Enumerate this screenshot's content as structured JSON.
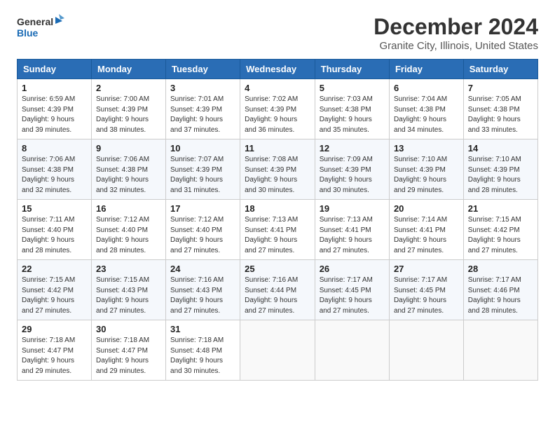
{
  "logo": {
    "line1": "General",
    "line2": "Blue"
  },
  "title": "December 2024",
  "subtitle": "Granite City, Illinois, United States",
  "headers": [
    "Sunday",
    "Monday",
    "Tuesday",
    "Wednesday",
    "Thursday",
    "Friday",
    "Saturday"
  ],
  "weeks": [
    [
      {
        "day": "1",
        "sunrise": "6:59 AM",
        "sunset": "4:39 PM",
        "daylight": "9 hours and 39 minutes."
      },
      {
        "day": "2",
        "sunrise": "7:00 AM",
        "sunset": "4:39 PM",
        "daylight": "9 hours and 38 minutes."
      },
      {
        "day": "3",
        "sunrise": "7:01 AM",
        "sunset": "4:39 PM",
        "daylight": "9 hours and 37 minutes."
      },
      {
        "day": "4",
        "sunrise": "7:02 AM",
        "sunset": "4:39 PM",
        "daylight": "9 hours and 36 minutes."
      },
      {
        "day": "5",
        "sunrise": "7:03 AM",
        "sunset": "4:38 PM",
        "daylight": "9 hours and 35 minutes."
      },
      {
        "day": "6",
        "sunrise": "7:04 AM",
        "sunset": "4:38 PM",
        "daylight": "9 hours and 34 minutes."
      },
      {
        "day": "7",
        "sunrise": "7:05 AM",
        "sunset": "4:38 PM",
        "daylight": "9 hours and 33 minutes."
      }
    ],
    [
      {
        "day": "8",
        "sunrise": "7:06 AM",
        "sunset": "4:38 PM",
        "daylight": "9 hours and 32 minutes."
      },
      {
        "day": "9",
        "sunrise": "7:06 AM",
        "sunset": "4:38 PM",
        "daylight": "9 hours and 32 minutes."
      },
      {
        "day": "10",
        "sunrise": "7:07 AM",
        "sunset": "4:39 PM",
        "daylight": "9 hours and 31 minutes."
      },
      {
        "day": "11",
        "sunrise": "7:08 AM",
        "sunset": "4:39 PM",
        "daylight": "9 hours and 30 minutes."
      },
      {
        "day": "12",
        "sunrise": "7:09 AM",
        "sunset": "4:39 PM",
        "daylight": "9 hours and 30 minutes."
      },
      {
        "day": "13",
        "sunrise": "7:10 AM",
        "sunset": "4:39 PM",
        "daylight": "9 hours and 29 minutes."
      },
      {
        "day": "14",
        "sunrise": "7:10 AM",
        "sunset": "4:39 PM",
        "daylight": "9 hours and 28 minutes."
      }
    ],
    [
      {
        "day": "15",
        "sunrise": "7:11 AM",
        "sunset": "4:40 PM",
        "daylight": "9 hours and 28 minutes."
      },
      {
        "day": "16",
        "sunrise": "7:12 AM",
        "sunset": "4:40 PM",
        "daylight": "9 hours and 28 minutes."
      },
      {
        "day": "17",
        "sunrise": "7:12 AM",
        "sunset": "4:40 PM",
        "daylight": "9 hours and 27 minutes."
      },
      {
        "day": "18",
        "sunrise": "7:13 AM",
        "sunset": "4:41 PM",
        "daylight": "9 hours and 27 minutes."
      },
      {
        "day": "19",
        "sunrise": "7:13 AM",
        "sunset": "4:41 PM",
        "daylight": "9 hours and 27 minutes."
      },
      {
        "day": "20",
        "sunrise": "7:14 AM",
        "sunset": "4:41 PM",
        "daylight": "9 hours and 27 minutes."
      },
      {
        "day": "21",
        "sunrise": "7:15 AM",
        "sunset": "4:42 PM",
        "daylight": "9 hours and 27 minutes."
      }
    ],
    [
      {
        "day": "22",
        "sunrise": "7:15 AM",
        "sunset": "4:42 PM",
        "daylight": "9 hours and 27 minutes."
      },
      {
        "day": "23",
        "sunrise": "7:15 AM",
        "sunset": "4:43 PM",
        "daylight": "9 hours and 27 minutes."
      },
      {
        "day": "24",
        "sunrise": "7:16 AM",
        "sunset": "4:43 PM",
        "daylight": "9 hours and 27 minutes."
      },
      {
        "day": "25",
        "sunrise": "7:16 AM",
        "sunset": "4:44 PM",
        "daylight": "9 hours and 27 minutes."
      },
      {
        "day": "26",
        "sunrise": "7:17 AM",
        "sunset": "4:45 PM",
        "daylight": "9 hours and 27 minutes."
      },
      {
        "day": "27",
        "sunrise": "7:17 AM",
        "sunset": "4:45 PM",
        "daylight": "9 hours and 27 minutes."
      },
      {
        "day": "28",
        "sunrise": "7:17 AM",
        "sunset": "4:46 PM",
        "daylight": "9 hours and 28 minutes."
      }
    ],
    [
      {
        "day": "29",
        "sunrise": "7:18 AM",
        "sunset": "4:47 PM",
        "daylight": "9 hours and 29 minutes."
      },
      {
        "day": "30",
        "sunrise": "7:18 AM",
        "sunset": "4:47 PM",
        "daylight": "9 hours and 29 minutes."
      },
      {
        "day": "31",
        "sunrise": "7:18 AM",
        "sunset": "4:48 PM",
        "daylight": "9 hours and 30 minutes."
      },
      null,
      null,
      null,
      null
    ]
  ],
  "labels": {
    "sunrise": "Sunrise:",
    "sunset": "Sunset:",
    "daylight": "Daylight:"
  }
}
